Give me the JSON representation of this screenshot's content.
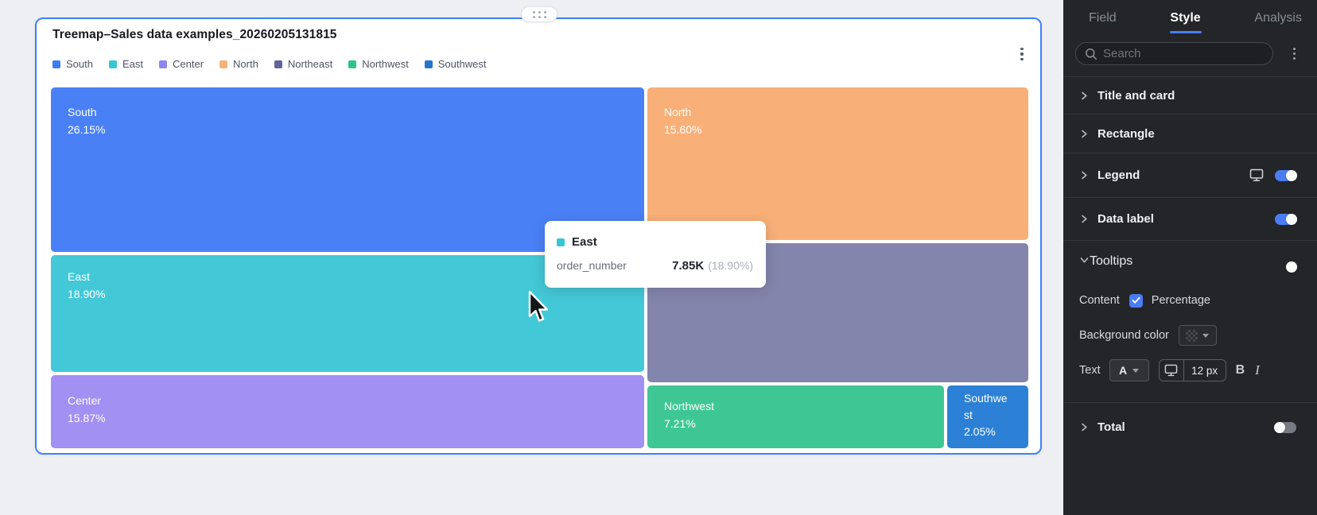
{
  "card": {
    "title": "Treemap–Sales data examples_20260205131815",
    "border_color": "#3d82f7"
  },
  "legend": {
    "items": [
      {
        "label": "South",
        "color": "#3f7bf4"
      },
      {
        "label": "East",
        "color": "#38c5d2"
      },
      {
        "label": "Center",
        "color": "#8d85ee"
      },
      {
        "label": "North",
        "color": "#f8b277"
      },
      {
        "label": "Northeast",
        "color": "#62639b"
      },
      {
        "label": "Northwest",
        "color": "#2ec489"
      },
      {
        "label": "Southwest",
        "color": "#2277cd"
      }
    ]
  },
  "chart_data": {
    "type": "treemap",
    "title": "Treemap–Sales data examples_20260205131815",
    "metric": "order_number",
    "items": [
      {
        "name": "South",
        "percent": 26.15,
        "percent_label": "26.15%",
        "color": "#4a80f6"
      },
      {
        "name": "North",
        "percent": 15.6,
        "percent_label": "15.60%",
        "color": "#f9b078"
      },
      {
        "name": "East",
        "percent": 18.9,
        "percent_label": "18.90%",
        "value": "7.85K",
        "color": "#43c8d7"
      },
      {
        "name": "Northeast",
        "color": "#8385ac"
      },
      {
        "name": "Center",
        "percent": 15.87,
        "percent_label": "15.87%",
        "color": "#a290f2"
      },
      {
        "name": "Northwest",
        "percent": 7.21,
        "percent_label": "7.21%",
        "color": "#3ec795"
      },
      {
        "name": "Southwest",
        "percent": 2.05,
        "percent_label": "2.05%",
        "color": "#2c81d6"
      }
    ]
  },
  "tooltip": {
    "series": "East",
    "swatch_color": "#38c5d2",
    "metric": "order_number",
    "value": "7.85K",
    "percent": "(18.90%)"
  },
  "panel": {
    "tabs": {
      "field": "Field",
      "style": "Style",
      "analysis": "Analysis",
      "active": "Style"
    },
    "search_placeholder": "Search",
    "accent_color": "#4a7df5",
    "sections": {
      "title_and_card": "Title and card",
      "rectangle": "Rectangle",
      "legend": "Legend",
      "data_label": "Data label",
      "tooltips": "Tooltips",
      "total": "Total"
    },
    "toggles": {
      "legend": "on",
      "data_label": "on",
      "tooltips": "on",
      "total": "off"
    },
    "tooltips_settings": {
      "content_label": "Content",
      "content_option": "Percentage",
      "content_checked": true,
      "background_color_label": "Background color",
      "text_label": "Text",
      "font_color_letter": "A",
      "font_size": "12 px",
      "bold": "B",
      "italic": "I"
    }
  }
}
